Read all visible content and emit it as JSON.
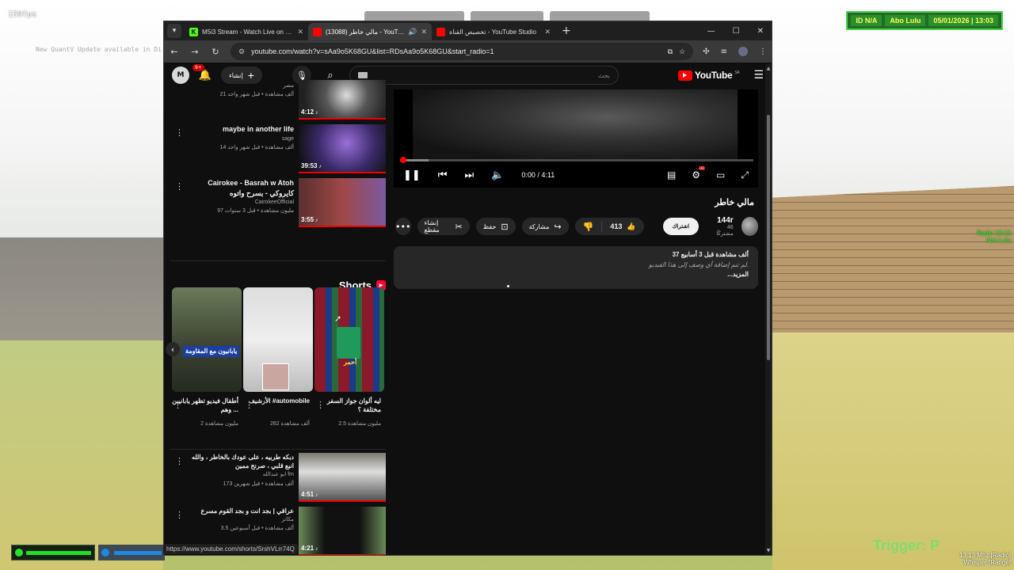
{
  "overlay": {
    "fps": "159fps",
    "notice": "New QuantV Update available in Discord",
    "hud": {
      "id": "ID N/A",
      "name": "Abo Lulu",
      "date": "05/01/2026 | 13:03"
    },
    "radio": "Radio 13:13",
    "radio_name": "Abo Lulu",
    "trigger": "Trigger: P",
    "freq": "13.13 Mhz [Radio]",
    "mode": "Whisper [Range]",
    "status_url": "https://www.youtube.com/shorts/SrshVLrr74Q"
  },
  "browser": {
    "tabs": [
      {
        "label": "M5i3 Stream - Watch Live on Kick",
        "fav": "K",
        "fav_color": "#53fc18",
        "active": false
      },
      {
        "label": "مالي خاطر (13088) - YouTube",
        "fav": "",
        "fav_color": "#ff0000",
        "active": true
      },
      {
        "label": "تخصيص القناة - YouTube Studio",
        "fav": "",
        "fav_color": "#ff0000",
        "active": false
      }
    ],
    "url": "youtube.com/watch?v=sAa9o5K68GU&list=RDsAa9o5K68GU&start_radio=1"
  },
  "yt": {
    "notif_count": "9+",
    "create_label": "إنشاء",
    "search_placeholder": "بحث",
    "logo": "YouTube",
    "country": "SA"
  },
  "related_top": [
    {
      "title": "",
      "channel": "مصر",
      "meta": "21 ألف مشاهدة • قبل شهر واحد",
      "duration": "4:12"
    },
    {
      "title": "maybe in another life",
      "channel": "sage",
      "meta": "14 ألف مشاهدة • قبل شهر واحد",
      "duration": "39:53"
    },
    {
      "title": "Cairokee - Basrah w Atoh كايروكي - بسرح واتوه",
      "channel": "CairokeeOfficial",
      "meta": "97 مليون مشاهدة • قبل 3 سنوات",
      "duration": "3:55"
    }
  ],
  "shorts": {
    "heading": "Shorts",
    "items": [
      {
        "title": "أطفال فيديو تظهر يابانيين وهم ...",
        "meta": "2 مليون مشاهدة",
        "caption": "يابانيون مع المقاومة"
      },
      {
        "title": "الأرشيف #automobile",
        "meta": "262 ألف مشاهدة",
        "caption": ""
      },
      {
        "title": "ليه ألوان جواز السفر مختلفة ؟",
        "meta": "2.5 مليون مشاهدة",
        "caption": "أحمر"
      }
    ]
  },
  "related_bottom": [
    {
      "title": "دبكه طربيه ، على عودك بالخاطر ، والله انبع قلبي ، صرنح ممين",
      "channel": "ابو عبدالله fm",
      "meta": "173 ألف مشاهدة • قبل شهرين",
      "duration": "4:51"
    },
    {
      "title": "عراقي | بجد انت و بجد القوم مسرع",
      "channel": "مكاتر",
      "meta": "3.5 ألف مشاهدة • قبل أسبوعين",
      "duration": "4:21"
    }
  ],
  "player": {
    "time": "0:00 / 4:11",
    "progress_fraction": 0.0
  },
  "video": {
    "title": "مالي خاطر",
    "channel_name": "144r",
    "subscribers": "46 مشتركًا",
    "subscribe_label": "اشتراك",
    "likes": "413",
    "share_label": "مشاركة",
    "save_label": "حفظ",
    "clip_label": "إنشاء مقطع",
    "views_date": "37 ألف مشاهدة  قبل 3 أسابيع",
    "description": "لم تتم إضافة أي وصف إلى هذا الفيديو.",
    "more_label": "...المزيد"
  }
}
